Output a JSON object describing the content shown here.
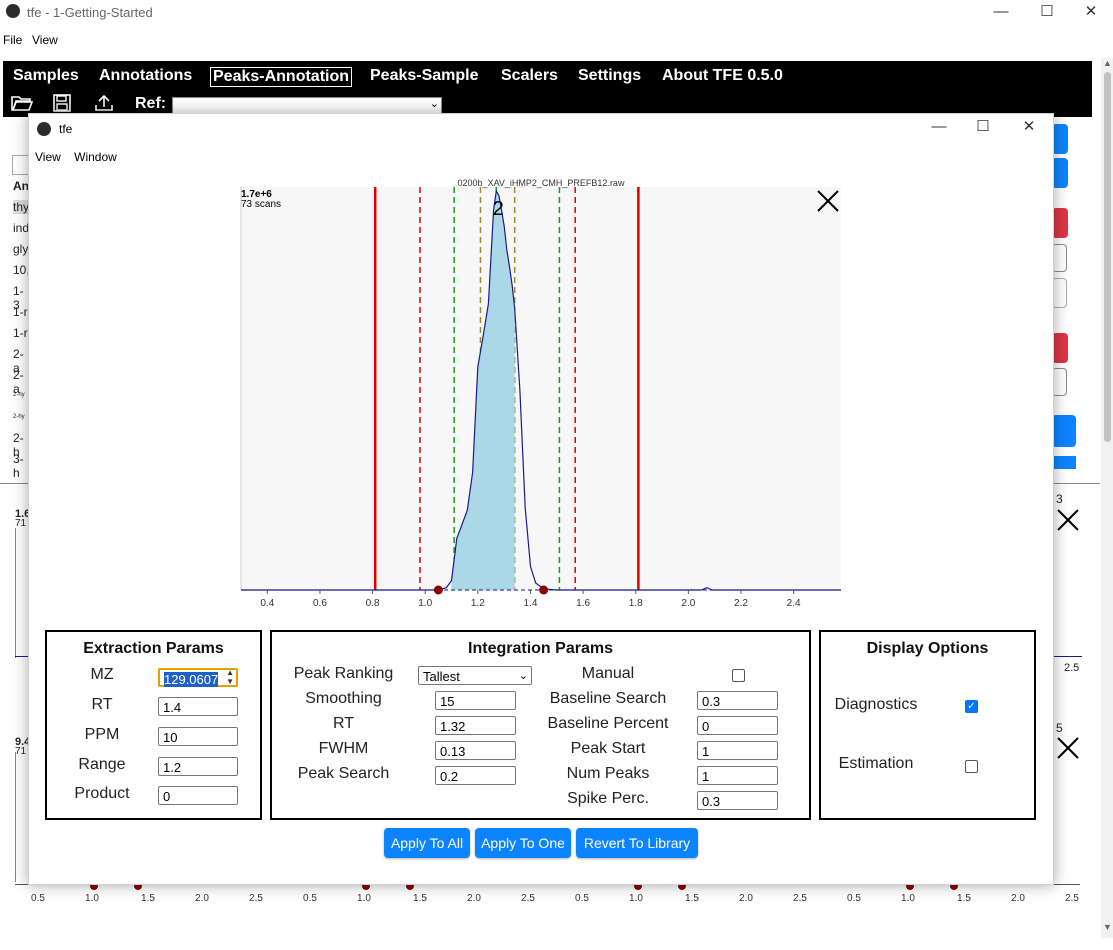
{
  "window": {
    "title": "tfe - 1-Getting-Started",
    "minimize": "—",
    "maximize": "☐",
    "close": "✕"
  },
  "menu": {
    "file": "File",
    "view": "View"
  },
  "nav": {
    "samples": "Samples",
    "annotations": "Annotations",
    "peaks_annotation": "Peaks-Annotation",
    "peaks_sample": "Peaks-Sample",
    "scalers": "Scalers",
    "settings": "Settings",
    "about": "About TFE 0.5.0"
  },
  "toolbar": {
    "ref_label": "Ref:",
    "ref_value": ""
  },
  "background": {
    "list_header": "An",
    "list_items": [
      "thy",
      "ind",
      "gly",
      "10,",
      "1-3",
      "1-r",
      "1-r",
      "2-a",
      "2-a",
      "2-hy",
      "2-hy",
      "2-h",
      "3-h"
    ],
    "plot_left_top": "1.6",
    "plot_left_top_sub": "71",
    "plot_left_mid": "9.4",
    "plot_left_mid_sub": "71",
    "right_num_1": "3",
    "right_num_2": "5",
    "right_axis_label": "2.5",
    "bottom_ticks": [
      "0.5",
      "1.0",
      "1.5",
      "2.0",
      "2.5"
    ]
  },
  "modal": {
    "title": "tfe",
    "menu_view": "View",
    "menu_window": "Window",
    "close_plot_icon": "close-icon"
  },
  "chart_data": {
    "type": "area",
    "title": "0200b_XAV_iHMP2_CMH_PREFB12.raw",
    "intensity_label": "1.7e+6",
    "scans_label": "73 scans",
    "peak_label": "2",
    "x_ticks": [
      "0.4",
      "0.6",
      "0.8",
      "1.0",
      "1.2",
      "1.4",
      "1.6",
      "1.8",
      "2.0",
      "2.2",
      "2.4"
    ],
    "xlim": [
      0.3,
      2.58
    ],
    "ylim": [
      0,
      1.7
    ],
    "trace": {
      "x": [
        0.3,
        0.9,
        1.05,
        1.08,
        1.1,
        1.12,
        1.14,
        1.16,
        1.18,
        1.2,
        1.22,
        1.24,
        1.25,
        1.26,
        1.27,
        1.28,
        1.29,
        1.3,
        1.31,
        1.32,
        1.33,
        1.34,
        1.36,
        1.38,
        1.4,
        1.42,
        1.45,
        1.5,
        1.9,
        2.05,
        2.07,
        2.09,
        2.58
      ],
      "y": [
        0.0,
        0.0,
        0.0,
        0.01,
        0.04,
        0.22,
        0.28,
        0.34,
        0.5,
        0.95,
        1.08,
        1.22,
        1.42,
        1.62,
        1.7,
        1.68,
        1.62,
        1.55,
        1.45,
        1.38,
        1.3,
        1.2,
        0.85,
        0.35,
        0.1,
        0.03,
        0.005,
        0.0,
        0.0,
        0.0,
        0.01,
        0.0,
        0.0
      ]
    },
    "fill_range": [
      1.1,
      1.34
    ],
    "endpoints": [
      1.05,
      1.45
    ],
    "lines": [
      {
        "x": 0.81,
        "color": "#e00000",
        "style": "solid"
      },
      {
        "x": 1.81,
        "color": "#e00000",
        "style": "solid"
      },
      {
        "x": 0.98,
        "color": "#e00000",
        "style": "dashed"
      },
      {
        "x": 1.57,
        "color": "#e00000",
        "style": "dashed"
      },
      {
        "x": 1.11,
        "color": "#1a9a1a",
        "style": "dashed"
      },
      {
        "x": 1.51,
        "color": "#1a9a1a",
        "style": "dashed"
      },
      {
        "x": 1.21,
        "color": "#a08a30",
        "style": "dashed"
      },
      {
        "x": 1.34,
        "color": "#a08a30",
        "style": "dashed"
      },
      {
        "x": 1.27,
        "color": "#1a9a1a",
        "style": "dashed"
      }
    ]
  },
  "extraction": {
    "title": "Extraction Params",
    "mz_label": "MZ",
    "mz_value": "129.0607",
    "rt_label": "RT",
    "rt_value": "1.4",
    "ppm_label": "PPM",
    "ppm_value": "10",
    "range_label": "Range",
    "range_value": "1.2",
    "product_label": "Product",
    "product_value": "0"
  },
  "integration": {
    "title": "Integration Params",
    "peak_ranking_label": "Peak Ranking",
    "peak_ranking_value": "Tallest",
    "smoothing_label": "Smoothing",
    "smoothing_value": "15",
    "rt_label": "RT",
    "rt_value": "1.32",
    "fwhm_label": "FWHM",
    "fwhm_value": "0.13",
    "peak_search_label": "Peak Search",
    "peak_search_value": "0.2",
    "manual_label": "Manual",
    "manual_checked": false,
    "baseline_search_label": "Baseline Search",
    "baseline_search_value": "0.3",
    "baseline_percent_label": "Baseline Percent",
    "baseline_percent_value": "0",
    "peak_start_label": "Peak Start",
    "peak_start_value": "1",
    "num_peaks_label": "Num Peaks",
    "num_peaks_value": "1",
    "spike_perc_label": "Spike Perc.",
    "spike_perc_value": "0.3"
  },
  "display": {
    "title": "Display Options",
    "diagnostics_label": "Diagnostics",
    "diagnostics_checked": true,
    "estimation_label": "Estimation",
    "estimation_checked": false
  },
  "buttons": {
    "apply_all": "Apply To All",
    "apply_one": "Apply To One",
    "revert": "Revert To Library"
  },
  "colors": {
    "accent": "#0d84ff",
    "peak_fill": "#aad8e6",
    "trace": "#1a1a8c",
    "danger": "#dc3545"
  }
}
